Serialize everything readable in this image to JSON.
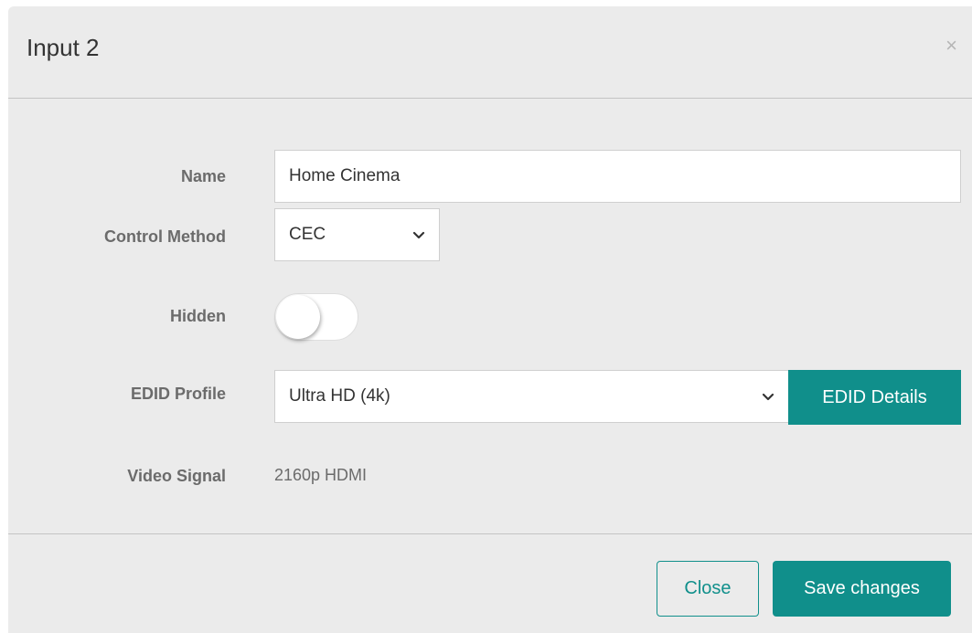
{
  "dialog": {
    "title": "Input 2",
    "close_icon": "×"
  },
  "form": {
    "name": {
      "label": "Name",
      "value": "Home Cinema"
    },
    "control_method": {
      "label": "Control Method",
      "value": "CEC"
    },
    "hidden": {
      "label": "Hidden",
      "checked": false
    },
    "edid_profile": {
      "label": "EDID Profile",
      "value": "Ultra HD (4k)",
      "details_button": "EDID Details"
    },
    "video_signal": {
      "label": "Video Signal",
      "value": "2160p HDMI"
    }
  },
  "footer": {
    "close_label": "Close",
    "save_label": "Save changes"
  },
  "colors": {
    "accent": "#108f8b",
    "background": "#ebebeb"
  },
  "icons": {
    "close": "close-icon",
    "dropdown": "chevron-down-icon"
  }
}
